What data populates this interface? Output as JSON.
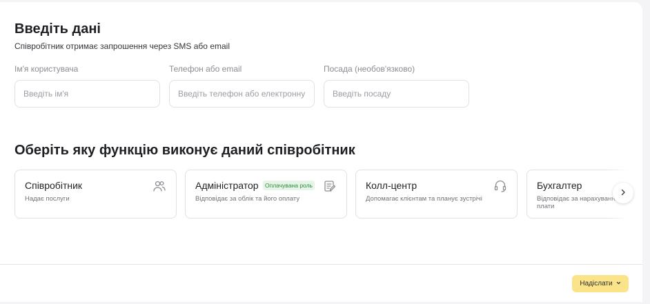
{
  "form": {
    "title": "Введіть дані",
    "subtitle": "Співробітник отримає запрошення через SMS або email",
    "fields": [
      {
        "label": "Ім'я користувача",
        "placeholder": "Введіть ім'я",
        "value": ""
      },
      {
        "label": "Телефон або email",
        "placeholder": "Введіть телефон або електронну пошту",
        "value": ""
      },
      {
        "label": "Посада (необов'язково)",
        "placeholder": "Введіть посаду",
        "value": ""
      }
    ]
  },
  "roles": {
    "title": "Оберіть яку функцію виконує даний співробітник",
    "items": [
      {
        "name": "Співробітник",
        "description": "Надає послуги",
        "icon": "users-icon"
      },
      {
        "name": "Адміністратор",
        "badge": "Оплачувана роль",
        "description": "Відповідає за облік та його оплату",
        "icon": "edit-document-icon"
      },
      {
        "name": "Колл-центр",
        "description": "Допомагає клієнтам та планує зустрічі",
        "icon": "headset-icon"
      },
      {
        "name": "Бухгалтер",
        "description": "Відповідає за нарахування заробітної плати",
        "icon": ""
      }
    ],
    "next_icon": "chevron-right-icon"
  },
  "footer": {
    "submit_label": "Надіслати",
    "submit_icon": "chevron-down-icon"
  },
  "colors": {
    "accent": "#fbe38a",
    "badge_bg": "#e6f5e8",
    "badge_text": "#2f8a3b",
    "border": "#dfe1e5",
    "background": "#f4f4f6"
  }
}
